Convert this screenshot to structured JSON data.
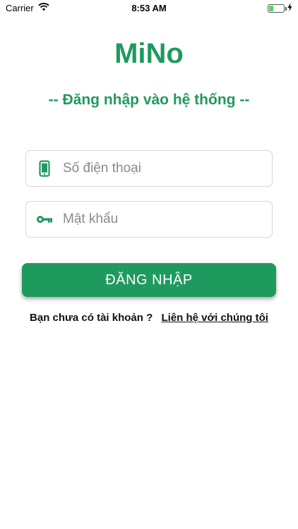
{
  "status_bar": {
    "carrier": "Carrier",
    "time": "8:53 AM",
    "battery_level": 0.3,
    "icons": [
      "wifi-icon",
      "battery-icon",
      "charging-icon"
    ]
  },
  "header": {
    "app_title": "MiNo",
    "subtitle": "-- Đăng nhập vào hệ thống --"
  },
  "form": {
    "phone": {
      "placeholder": "Số điện thoại",
      "value": "",
      "icon": "phone-icon"
    },
    "password": {
      "placeholder": "Mật khẩu",
      "value": "",
      "icon": "key-icon"
    },
    "login_label": "ĐĂNG NHẬP"
  },
  "footer": {
    "question": "Bạn chưa có tài khoản ?",
    "contact_link": "Liên hệ với chúng tôi"
  },
  "colors": {
    "brand_green": "#1f9a5f",
    "border": "#d6d6d6",
    "placeholder": "#8a8a8a"
  }
}
